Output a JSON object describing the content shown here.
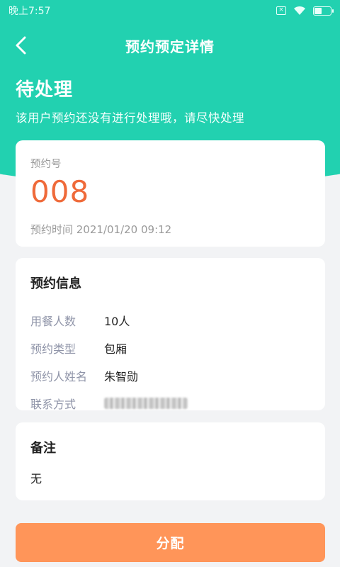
{
  "status_bar": {
    "time": "晚上7:57"
  },
  "nav": {
    "title": "预约预定详情",
    "back_icon": "chevron-left-icon"
  },
  "status": {
    "title": "待处理",
    "description": "该用户预约还没有进行处理哦，请尽快处理"
  },
  "order": {
    "label": "预约号",
    "number": "008",
    "time_text": "预约时间 2021/01/20 09:12"
  },
  "info": {
    "title": "预约信息",
    "rows": [
      {
        "key": "用餐人数",
        "value": "10人"
      },
      {
        "key": "预约类型",
        "value": "包厢"
      },
      {
        "key": "预约人姓名",
        "value": "朱智勋"
      },
      {
        "key": "联系方式",
        "value": ""
      }
    ]
  },
  "note": {
    "title": "备注",
    "text": "无"
  },
  "actions": {
    "assign_label": "分配"
  },
  "colors": {
    "header": "#22d1b0",
    "accent_orange": "#ef6a3a",
    "button": "#ff9559"
  }
}
